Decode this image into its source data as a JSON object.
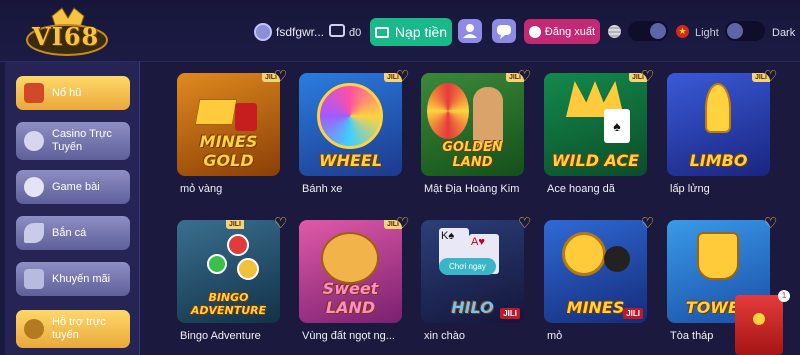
{
  "header": {
    "username": "fsdfgwr...",
    "balance": "đ0",
    "deposit_label": "Nạp tiền",
    "logout_label": "Đăng xuất",
    "light_label": "Light",
    "dark_label": "Dark",
    "logo_text": "VI68"
  },
  "sidebar": {
    "items": [
      {
        "label": "Nổ hũ",
        "icon": "slot-machine-icon",
        "active": true
      },
      {
        "label": "Casino Trực Tuyến",
        "icon": "poker-chip-icon",
        "active": false
      },
      {
        "label": "Game bài",
        "icon": "cards-icon",
        "active": false
      },
      {
        "label": "Bắn cá",
        "icon": "fish-icon",
        "active": false
      },
      {
        "label": "Khuyến mãi",
        "icon": "gift-icon",
        "active": false
      },
      {
        "label": "Hỗ trợ trực tuyến",
        "icon": "support-24-icon",
        "active": true
      }
    ]
  },
  "games": [
    {
      "name": "mỏ vàng",
      "title": "MINES GOLD",
      "tag": "JILI"
    },
    {
      "name": "Bánh xe",
      "title": "WHEEL",
      "tag": "JILI"
    },
    {
      "name": "Mật Địa Hoàng Kim",
      "title": "GOLDEN LAND",
      "tag": "JILI"
    },
    {
      "name": "Ace hoang dã",
      "title": "WILD ACE",
      "tag": "JILI"
    },
    {
      "name": "lấp lửng",
      "title": "LIMBO",
      "tag": "JILI"
    },
    {
      "name": "Bingo Adventure",
      "title": "BINGO ADVENTURE",
      "tag": "JILI"
    },
    {
      "name": "Vùng đất ngọt ng...",
      "title": "Sweet LAND",
      "tag": "JILI"
    },
    {
      "name": "xin chào",
      "title": "HILO",
      "tag": "JILI"
    },
    {
      "name": "mỏ",
      "title": "MINES",
      "tag": "JILI"
    },
    {
      "name": "Tòa tháp",
      "title": "TOWER",
      "tag": ""
    }
  ],
  "hover": {
    "play_label": "Chơi ngay"
  },
  "gift_badge": "1",
  "colors": {
    "deposit": "#19b98a",
    "logout": "#c42a74",
    "accent_gold": "#ffd23e",
    "background": "#1b1a3e"
  }
}
